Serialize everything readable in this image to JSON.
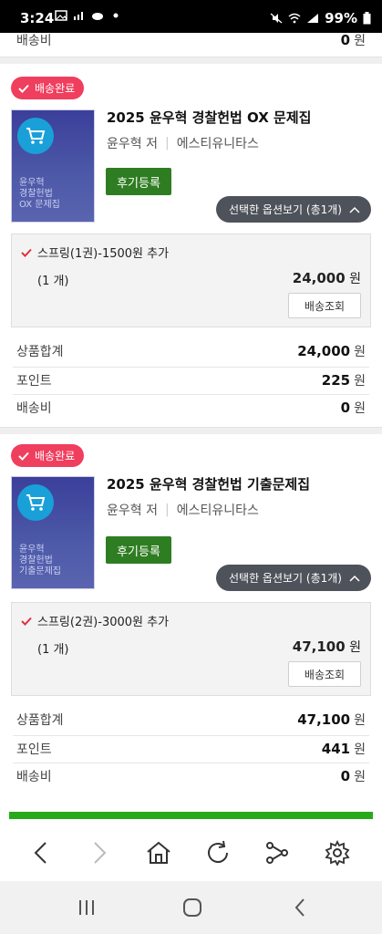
{
  "status_bar": {
    "time": "3:24",
    "battery": "99%"
  },
  "top_summary": {
    "shipping_label": "배송비",
    "shipping_value": "0",
    "currency": "원"
  },
  "orders": [
    {
      "status_badge": "배송완료",
      "title": "2025 윤우혁 경찰헌법 OX 문제집",
      "author": "윤우혁 저",
      "publisher": "에스티유니타스",
      "cover_text": "윤우혁\n경찰헌법\nOX 문제집",
      "review_button": "후기등록",
      "options_button": "선택한 옵션보기 (총1개)",
      "option": {
        "name": "스프링(1권)-1500원 추가",
        "quantity": "(1 개)",
        "price": "24,000",
        "currency": "원",
        "ship_button": "배송조회"
      },
      "summary": {
        "total_label": "상품합계",
        "total_value": "24,000",
        "points_label": "포인트",
        "points_value": "225",
        "shipping_label": "배송비",
        "shipping_value": "0",
        "currency": "원"
      }
    },
    {
      "status_badge": "배송완료",
      "title": "2025 윤우혁 경찰헌법 기출문제집",
      "author": "윤우혁 저",
      "publisher": "에스티유니타스",
      "cover_text": "윤우혁\n경찰헌법\n기출문제집",
      "review_button": "후기등록",
      "options_button": "선택한 옵션보기 (총1개)",
      "option": {
        "name": "스프링(2권)-3000원 추가",
        "quantity": "(1 개)",
        "price": "47,100",
        "currency": "원",
        "ship_button": "배송조회"
      },
      "summary": {
        "total_label": "상품합계",
        "total_value": "47,100",
        "points_label": "포인트",
        "points_value": "441",
        "shipping_label": "배송비",
        "shipping_value": "0",
        "currency": "원"
      }
    }
  ],
  "page_progress": 1.0,
  "colors": {
    "badge": "#f03e5e",
    "review_button": "#2f7d22",
    "options_button": "#4e525a",
    "progress": "#28a91a"
  },
  "toolbar_icons": [
    "back-icon",
    "forward-icon",
    "home-icon",
    "refresh-icon",
    "share-icon",
    "settings-icon"
  ],
  "navbar_icons": [
    "recent-apps-icon",
    "home-nav-icon",
    "back-nav-icon"
  ]
}
